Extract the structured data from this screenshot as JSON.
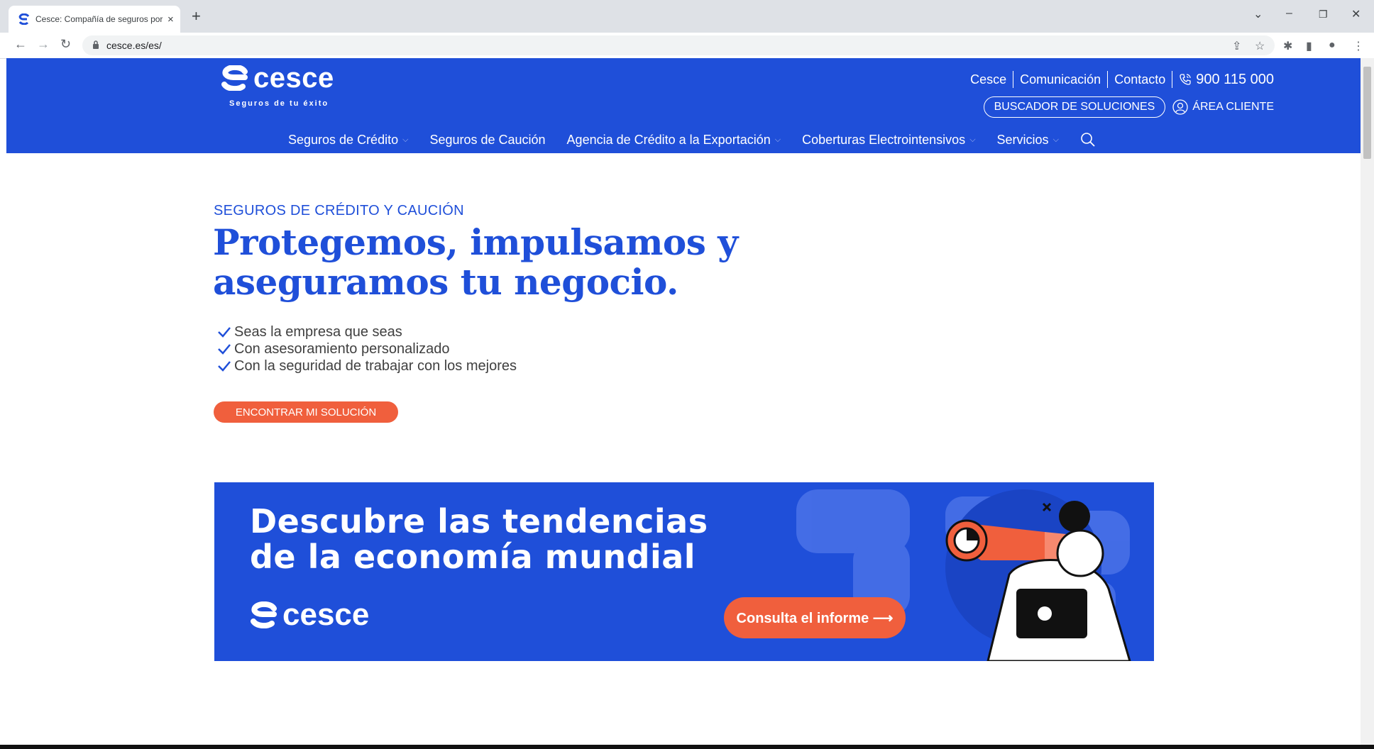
{
  "browser": {
    "tab_title": "Cesce: Compañía de seguros por",
    "tab_close": "×",
    "new_tab": "+",
    "url": "cesce.es/es/",
    "window_controls": {
      "dropdown": "⌄",
      "minimize": "–",
      "restore": "❐",
      "close": "✕"
    },
    "nav": {
      "back": "←",
      "forward": "→",
      "reload": "↻"
    },
    "icons": {
      "share": "⇪",
      "bookmark": "☆",
      "extensions": "✱",
      "sidepanel": "▮",
      "profile": "●",
      "menu": "⋮",
      "lock": "🔒"
    }
  },
  "header": {
    "logo_word": "cesce",
    "logo_tagline": "Seguros de tu éxito",
    "top_links": [
      "Cesce",
      "Comunicación",
      "Contacto"
    ],
    "phone": "900 115 000",
    "solutions_button": "BUSCADOR DE SOLUCIONES",
    "client_area": "ÁREA CLIENTE",
    "nav": [
      {
        "label": "Seguros de Crédito",
        "caret": "⌵"
      },
      {
        "label": "Seguros de Caución",
        "caret": ""
      },
      {
        "label": "Agencia de Crédito a la Exportación",
        "caret": "⌵"
      },
      {
        "label": "Coberturas Electrointensivos",
        "caret": "⌵"
      },
      {
        "label": "Servicios",
        "caret": "⌵"
      }
    ]
  },
  "hero": {
    "kicker": "SEGUROS DE CRÉDITO Y CAUCIÓN",
    "headline_line1": "Protegemos, impulsamos y",
    "headline_line2": "aseguramos tu negocio.",
    "checks": [
      "Seas la empresa que seas",
      "Con asesoramiento personalizado",
      "Con la seguridad de trabajar con los mejores"
    ],
    "cta": "ENCONTRAR MI SOLUCIÓN"
  },
  "banner": {
    "title_line1": "Descubre las tendencias",
    "title_line2": "de la economía mundial",
    "logo_word": "cesce",
    "cta": "Consulta el informe ⟶",
    "close": "✕"
  },
  "colors": {
    "brand_blue": "#1f4fd9",
    "accent_orange": "#f05f3d"
  }
}
